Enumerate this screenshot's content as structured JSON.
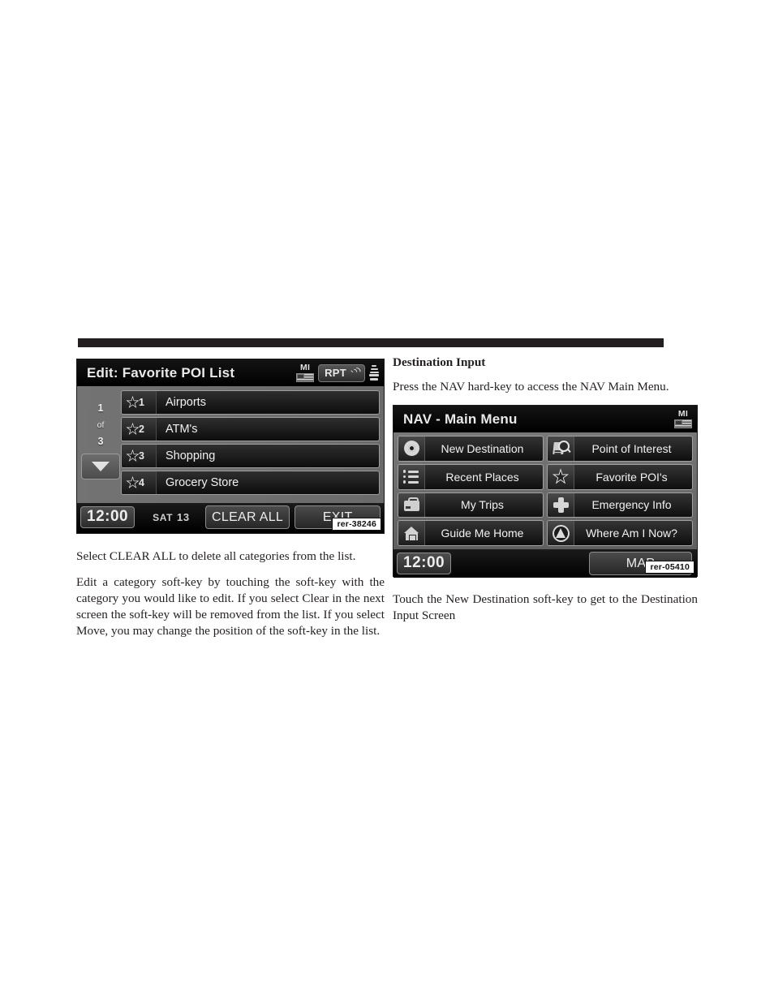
{
  "left_column": {
    "device": {
      "title": "Edit: Favorite POI List",
      "header_icons": {
        "unit_label": "MI",
        "unit_icon": "flag-icon",
        "rpt_label": "RPT",
        "rpt_icon": "sound-wave-icon",
        "speaker_icon": "speaker-icon"
      },
      "pager": {
        "current": "1",
        "of": "of",
        "total": "3",
        "down_icon": "chevron-down-icon"
      },
      "rows": [
        {
          "star_icon": "star-icon",
          "number": "1",
          "label": "Airports"
        },
        {
          "star_icon": "star-icon",
          "number": "2",
          "label": "ATM's"
        },
        {
          "star_icon": "star-icon",
          "number": "3",
          "label": "Shopping"
        },
        {
          "star_icon": "star-icon",
          "number": "4",
          "label": "Grocery Store"
        }
      ],
      "bottom": {
        "clock": "12:00",
        "day": "SAT",
        "date": "13",
        "clear_all": "CLEAR ALL",
        "exit": "EXIT"
      },
      "figure_id": "rer-38246"
    },
    "paragraphs": [
      "Select CLEAR ALL to delete all categories from the list.",
      "Edit a category soft-key by touching the soft-key with the category you would like to edit. If you select Clear in the next screen the soft-key will be removed from the list. If you select Move, you may change the position of the soft-key in the list."
    ]
  },
  "right_column": {
    "heading": "Destination Input",
    "intro": "Press the NAV hard-key to access the NAV Main Menu.",
    "device": {
      "title": "NAV - Main Menu",
      "header_icons": {
        "unit_label": "MI",
        "unit_icon": "flag-icon"
      },
      "keys": [
        {
          "icon": "target-icon",
          "label": "New Destination"
        },
        {
          "icon": "binoculars-icon",
          "label": "Point of Interest"
        },
        {
          "icon": "list-icon",
          "label": "Recent Places"
        },
        {
          "icon": "star-icon",
          "label": "Favorite POI's"
        },
        {
          "icon": "briefcase-icon",
          "label": "My Trips"
        },
        {
          "icon": "plus-cross-icon",
          "label": "Emergency Info"
        },
        {
          "icon": "home-icon",
          "label": "Guide Me Home"
        },
        {
          "icon": "compass-icon",
          "label": "Where Am I Now?"
        }
      ],
      "bottom": {
        "clock": "12:00",
        "map": "MAP"
      },
      "figure_id": "rer-05410"
    },
    "outro": "Touch the New Destination soft-key to get to the Destination Input Screen"
  },
  "colors": {
    "rule": "#231f20",
    "text": "#231f20",
    "screen_bg": "#000000",
    "panel_gray": "#6e6e6e"
  }
}
